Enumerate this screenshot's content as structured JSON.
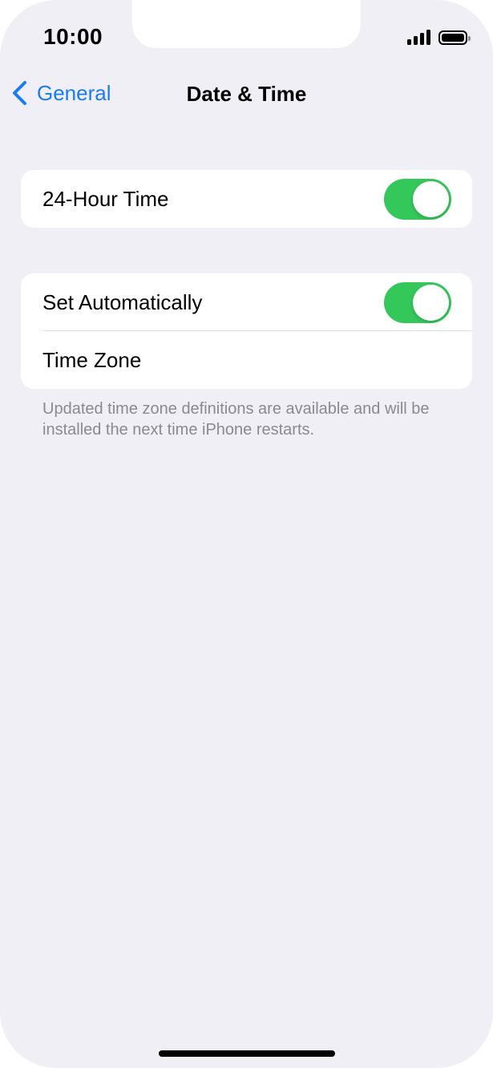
{
  "status_bar": {
    "time": "10:00",
    "signal_icon": "cellular-signal-icon",
    "battery_icon": "battery-full-icon"
  },
  "nav": {
    "back_label": "General",
    "back_icon": "chevron-left-icon",
    "title": "Date & Time"
  },
  "settings": {
    "group1": {
      "rows": [
        {
          "label": "24-Hour Time",
          "toggle_on": true
        }
      ]
    },
    "group2": {
      "rows": [
        {
          "label": "Set Automatically",
          "toggle_on": true
        },
        {
          "label": "Time Zone"
        }
      ]
    },
    "footnote": "Updated time zone definitions are available and will be installed the next time iPhone restarts."
  },
  "colors": {
    "accent": "#1a7cf2",
    "toggle_on": "#34c759",
    "background": "#f0eff5",
    "footnote": "#8a8a8e"
  }
}
